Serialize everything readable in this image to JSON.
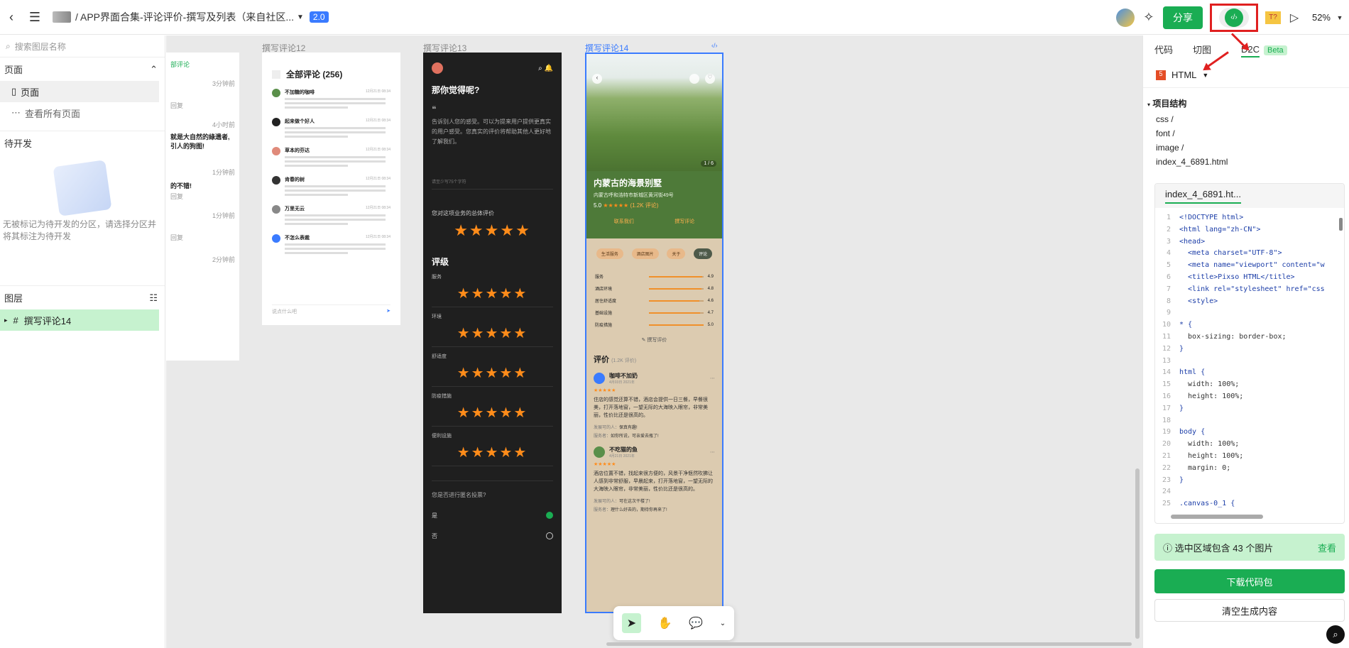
{
  "topbar": {
    "breadcrumb": "/ APP界面合集-评论评价-撰写及列表（来自社区...",
    "version": "2.0",
    "share_label": "分享",
    "zoom": "52%"
  },
  "left_panel": {
    "search_placeholder": "搜索图层名称",
    "pages_title": "页面",
    "page_item": "页面",
    "view_all": "查看所有页面",
    "dev_title": "待开发",
    "dev_empty": "无被标记为待开发的分区，请选择分区并将其标注为待开发",
    "layers_title": "图层",
    "layer_item": "撰写评论14"
  },
  "canvas": {
    "frames": [
      {
        "label": "撰写评论12",
        "title": "全部评论 (256)"
      },
      {
        "label": "撰写评论13",
        "question": "那你觉得呢?"
      },
      {
        "label": "撰写评论14",
        "title": "内蒙古的海景别墅"
      }
    ],
    "frame0_snippets": [
      "部评论",
      "3分钟前",
      "回复",
      "4小时前",
      "就是大自然的綠遗者,",
      "引人的狗图!",
      "1分钟前",
      "的不错!",
      "回复",
      "1分钟前",
      "回复",
      "2分钟前"
    ],
    "frame12_comments": [
      {
        "name": "不加糖的咖啡",
        "time": "12月21日 08:34"
      },
      {
        "name": "起来做个好人",
        "time": "12月21日 08:34"
      },
      {
        "name": "草本的芬达",
        "time": "12月21日 08:34"
      },
      {
        "name": "肯春的树",
        "time": "12月21日 08:34"
      },
      {
        "name": "万里无云",
        "time": "12月21日 08:34"
      },
      {
        "name": "不怎么表裁",
        "time": "12月21日 08:34"
      }
    ],
    "frame12_input": "说点什么吧",
    "frame13": {
      "quote": "告诉别人您的感受。可以为提来用户提供更真实的用户感受。您真实的评价将帮助其他人更好地了解我们。",
      "hint": "请至少写75个字符",
      "overall": "您对这项业务的总体评价",
      "rating_title": "评级",
      "categories": [
        "服务",
        "环境",
        "舒适度",
        "防疫措施",
        "便利设施"
      ],
      "anon_question": "您是否进行匿名投票?",
      "yes": "是",
      "no": "否"
    },
    "frame14": {
      "page_indicator": "1 / 6",
      "address": "内蒙古呼和浩特市新城区黄河街49号",
      "rating": "5.0",
      "rating_count": "(1.2K 评论)",
      "contact": "联系我们",
      "write_review": "撰写评论",
      "tabs": [
        "生活服务",
        "酒店图片",
        "关于",
        "评论"
      ],
      "bars": [
        {
          "label": "服务",
          "value": "4.9"
        },
        {
          "label": "酒店环境",
          "value": "4.8"
        },
        {
          "label": "居住舒适度",
          "value": "4.6"
        },
        {
          "label": "基础设施",
          "value": "4.7"
        },
        {
          "label": "防疫措施",
          "value": "5.0"
        }
      ],
      "write_link": "撰写评价",
      "reviews_title": "评价",
      "reviews_count": "(1.2K 评价)",
      "reviews": [
        {
          "name": "咖啡不加奶",
          "date": "4月03日 2021年",
          "text": "住店的感觉还算不错，酒店会提供一日三餐，早餐很美，打开落地窗，一望无际的大海映入眼帘，非常美丽，性价比还是很高的。",
          "owner_label": "发展可的人：",
          "owner_reply": "保真有趣!",
          "staff_label": "服务者：",
          "staff_reply": "如你所说，可亲爱去瓶了!"
        },
        {
          "name": "不吃猫的鱼",
          "date": "4月21日 2021年",
          "text": "酒店位置不错，找起来很方便的，风景干净惬然吹拂让人感到非常舒服，早晨起来，打开落地窗，一望无际的大海映入眼帘，非常美丽，性价比还是很高的。",
          "owner_label": "发展可的人：",
          "owner_reply": "可在这次干楼了!",
          "staff_label": "服务者：",
          "staff_reply": "理什么好去的，期待你再来了!"
        }
      ]
    }
  },
  "right_panel": {
    "tabs": [
      "代码",
      "切图",
      "D2C"
    ],
    "beta": "Beta",
    "language": "HTML",
    "project_title": "项目结构",
    "files": [
      "css /",
      "font /",
      "image /",
      "index_4_6891.html"
    ],
    "code_tab": "index_4_6891.ht...",
    "code": [
      "<!DOCTYPE html>",
      "<html lang=\"zh-CN\">",
      "<head>",
      "  <meta charset=\"UTF-8\">",
      "  <meta name=\"viewport\" content=\"w",
      "  <title>Pixso HTML</title>",
      "  <link rel=\"stylesheet\" href=\"css",
      "  <style>",
      "",
      "* {",
      "  box-sizing: border-box;",
      "}",
      "",
      "html {",
      "  width: 100%;",
      "  height: 100%;",
      "}",
      "",
      "body {",
      "  width: 100%;",
      "  height: 100%;",
      "  margin: 0;",
      "}",
      "",
      ".canvas-0_1 {"
    ],
    "info": "选中区域包含 43 个图片",
    "view": "查看",
    "download": "下载代码包",
    "clear": "清空生成内容"
  },
  "colors": {
    "accent": "#1aad53",
    "annotation": "#e02020",
    "star": "#ff8c1a",
    "selection": "#3a7bff"
  }
}
